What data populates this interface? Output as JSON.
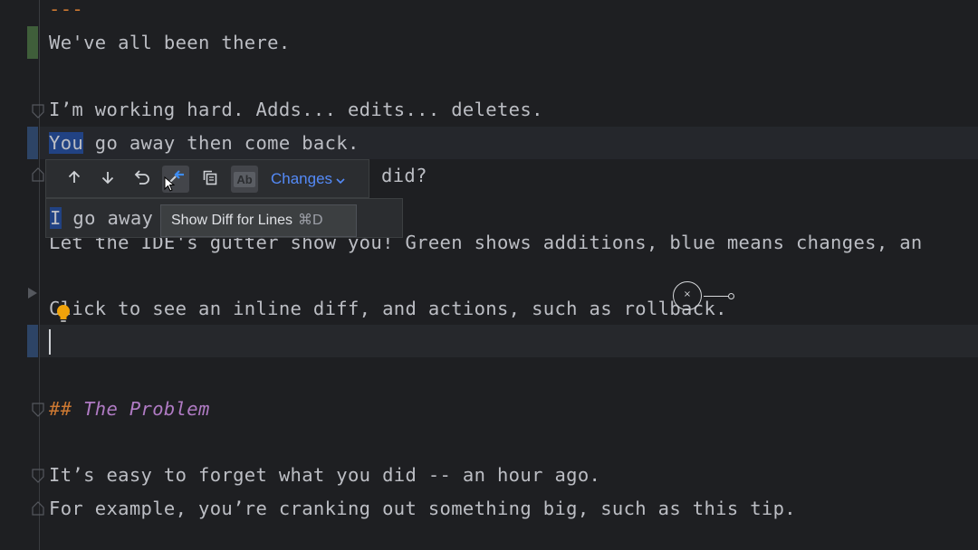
{
  "editor": {
    "lines": {
      "dashes": "---",
      "l1": "We've all been there.",
      "l2": "I’m working hard. Adds... edits... deletes.",
      "l3a": "You",
      "l3b": " go away then come back.",
      "l4": "did?",
      "l5a": "I",
      "l5b": " go away",
      "l6": "Let the IDE's gutter show you! Green shows additions, blue means changes, an",
      "l7": "Click to see an inline diff, and actions, such as rollback.",
      "h_hash": "##",
      "h_text": " The Problem",
      "l8": "It’s easy to forget what you did -- an hour ago.",
      "l9": "For example, you’re cranking out something big, such as this tip."
    }
  },
  "toolbar": {
    "prev_icon": "arrow-up-icon",
    "next_icon": "arrow-down-icon",
    "rollback_icon": "rollback-icon",
    "show_diff_icon": "show-diff-icon",
    "copy_icon": "copy-icon",
    "highlight_icon": "highlight-words-icon",
    "highlight_label": "Ab",
    "changes_label": "Changes"
  },
  "tooltip": {
    "text": "Show Diff for Lines",
    "shortcut": "⌘D"
  },
  "colors": {
    "background": "#1e1f22",
    "added": "#3f5e3a",
    "changed": "#2d4466",
    "accent": "#548af7"
  }
}
